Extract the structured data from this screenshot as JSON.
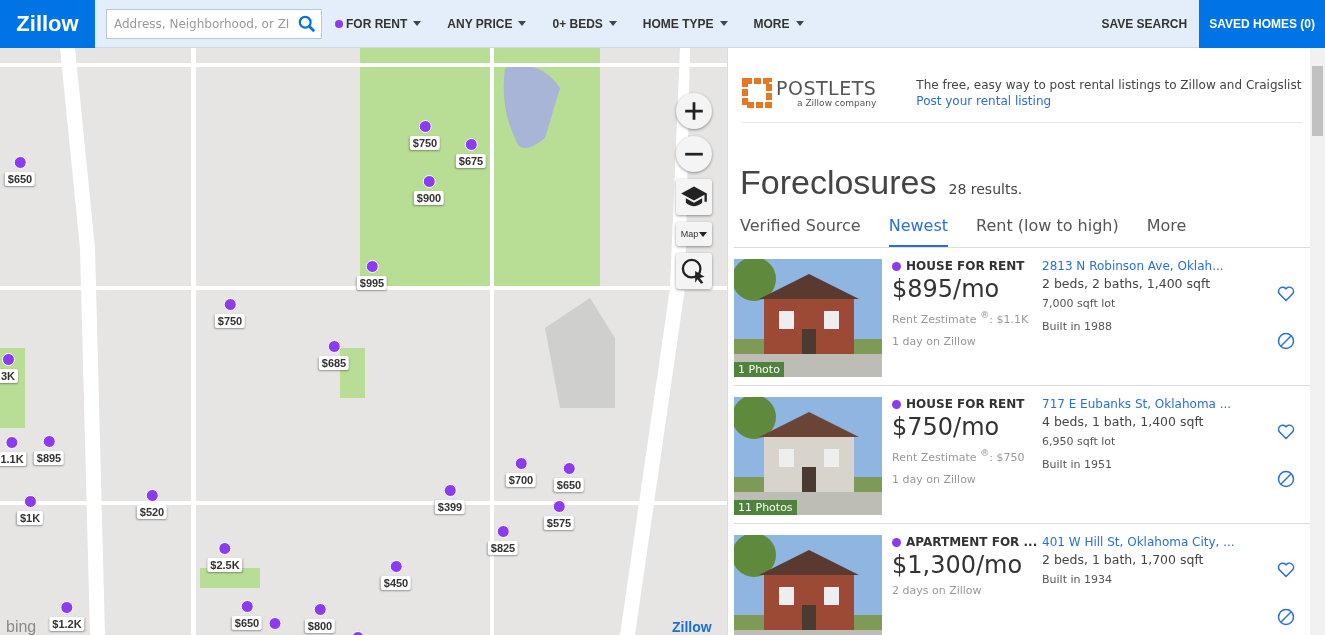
{
  "header": {
    "logo": "Zillow",
    "search": {
      "placeholder": "Address, Neighborhood, or ZI"
    },
    "filters": [
      {
        "label": "FOR RENT",
        "dot": true
      },
      {
        "label": "ANY PRICE",
        "dot": false
      },
      {
        "label": "0+ BEDS",
        "dot": false
      },
      {
        "label": "HOME TYPE",
        "dot": false
      },
      {
        "label": "MORE",
        "dot": false
      }
    ],
    "save_search": "SAVE SEARCH",
    "saved_homes": "SAVED HOMES (0)"
  },
  "map": {
    "pins": [
      {
        "price": "$650"
      },
      {
        "price": "$750"
      },
      {
        "price": "$675"
      },
      {
        "price": "$900"
      },
      {
        "price": "$995"
      },
      {
        "price": "$750"
      },
      {
        "price": "$685"
      },
      {
        "price": "3K"
      },
      {
        "price": "1.1K"
      },
      {
        "price": "$895"
      },
      {
        "price": "$1K"
      },
      {
        "price": "$520"
      },
      {
        "price": "$399"
      },
      {
        "price": "$700"
      },
      {
        "price": "$650"
      },
      {
        "price": "$575"
      },
      {
        "price": "$825"
      },
      {
        "price": "$2.5K"
      },
      {
        "price": "$450"
      },
      {
        "price": "$1.2K"
      },
      {
        "price": "$650"
      },
      {
        "price": "$800"
      }
    ],
    "map_type": "Map",
    "provider": "bing",
    "brand": "Zillow"
  },
  "promo": {
    "logo": "POSTLETS",
    "logo_sub": "a Zillow company",
    "text": "The free, easy way to post rental listings to Zillow and Craigslist",
    "link": "Post your rental listing"
  },
  "results": {
    "title": "Foreclosures",
    "count": "28 results."
  },
  "sort_tabs": [
    {
      "label": "Verified Source",
      "selected": false
    },
    {
      "label": "Newest",
      "selected": true
    },
    {
      "label": "Rent (low to high)",
      "selected": false
    },
    {
      "label": "More",
      "selected": false
    }
  ],
  "listings": [
    {
      "type": "HOUSE FOR RENT",
      "price": "$895/mo",
      "zestimate": "Rent Zestimate $^{®}$: $1.1K",
      "age": "1 day on Zillow",
      "photos": "1 Photo",
      "address": "2813 N Robinson Ave, Oklah...",
      "facts": "2 beds, 2 baths, 1,400 sqft",
      "lot": "7,000 sqft lot",
      "built": "Built in 1988"
    },
    {
      "type": "HOUSE FOR RENT",
      "price": "$750/mo",
      "zestimate": "Rent Zestimate $^{®}$: $750",
      "age": "1 day on Zillow",
      "photos": "11 Photos",
      "address": "717 E Eubanks St, Oklahoma ...",
      "facts": "4 beds, 1 bath, 1,400 sqft",
      "lot": "6,950 sqft lot",
      "built": "Built in 1951"
    },
    {
      "type": "APARTMENT FOR ...",
      "price": "$1,300/mo",
      "age": "2 days on Zillow",
      "address": "401 W Hill St, Oklahoma City, ...",
      "facts": "2 beds, 1 bath, 1,700 sqft",
      "built": "Built in 1934"
    }
  ]
}
